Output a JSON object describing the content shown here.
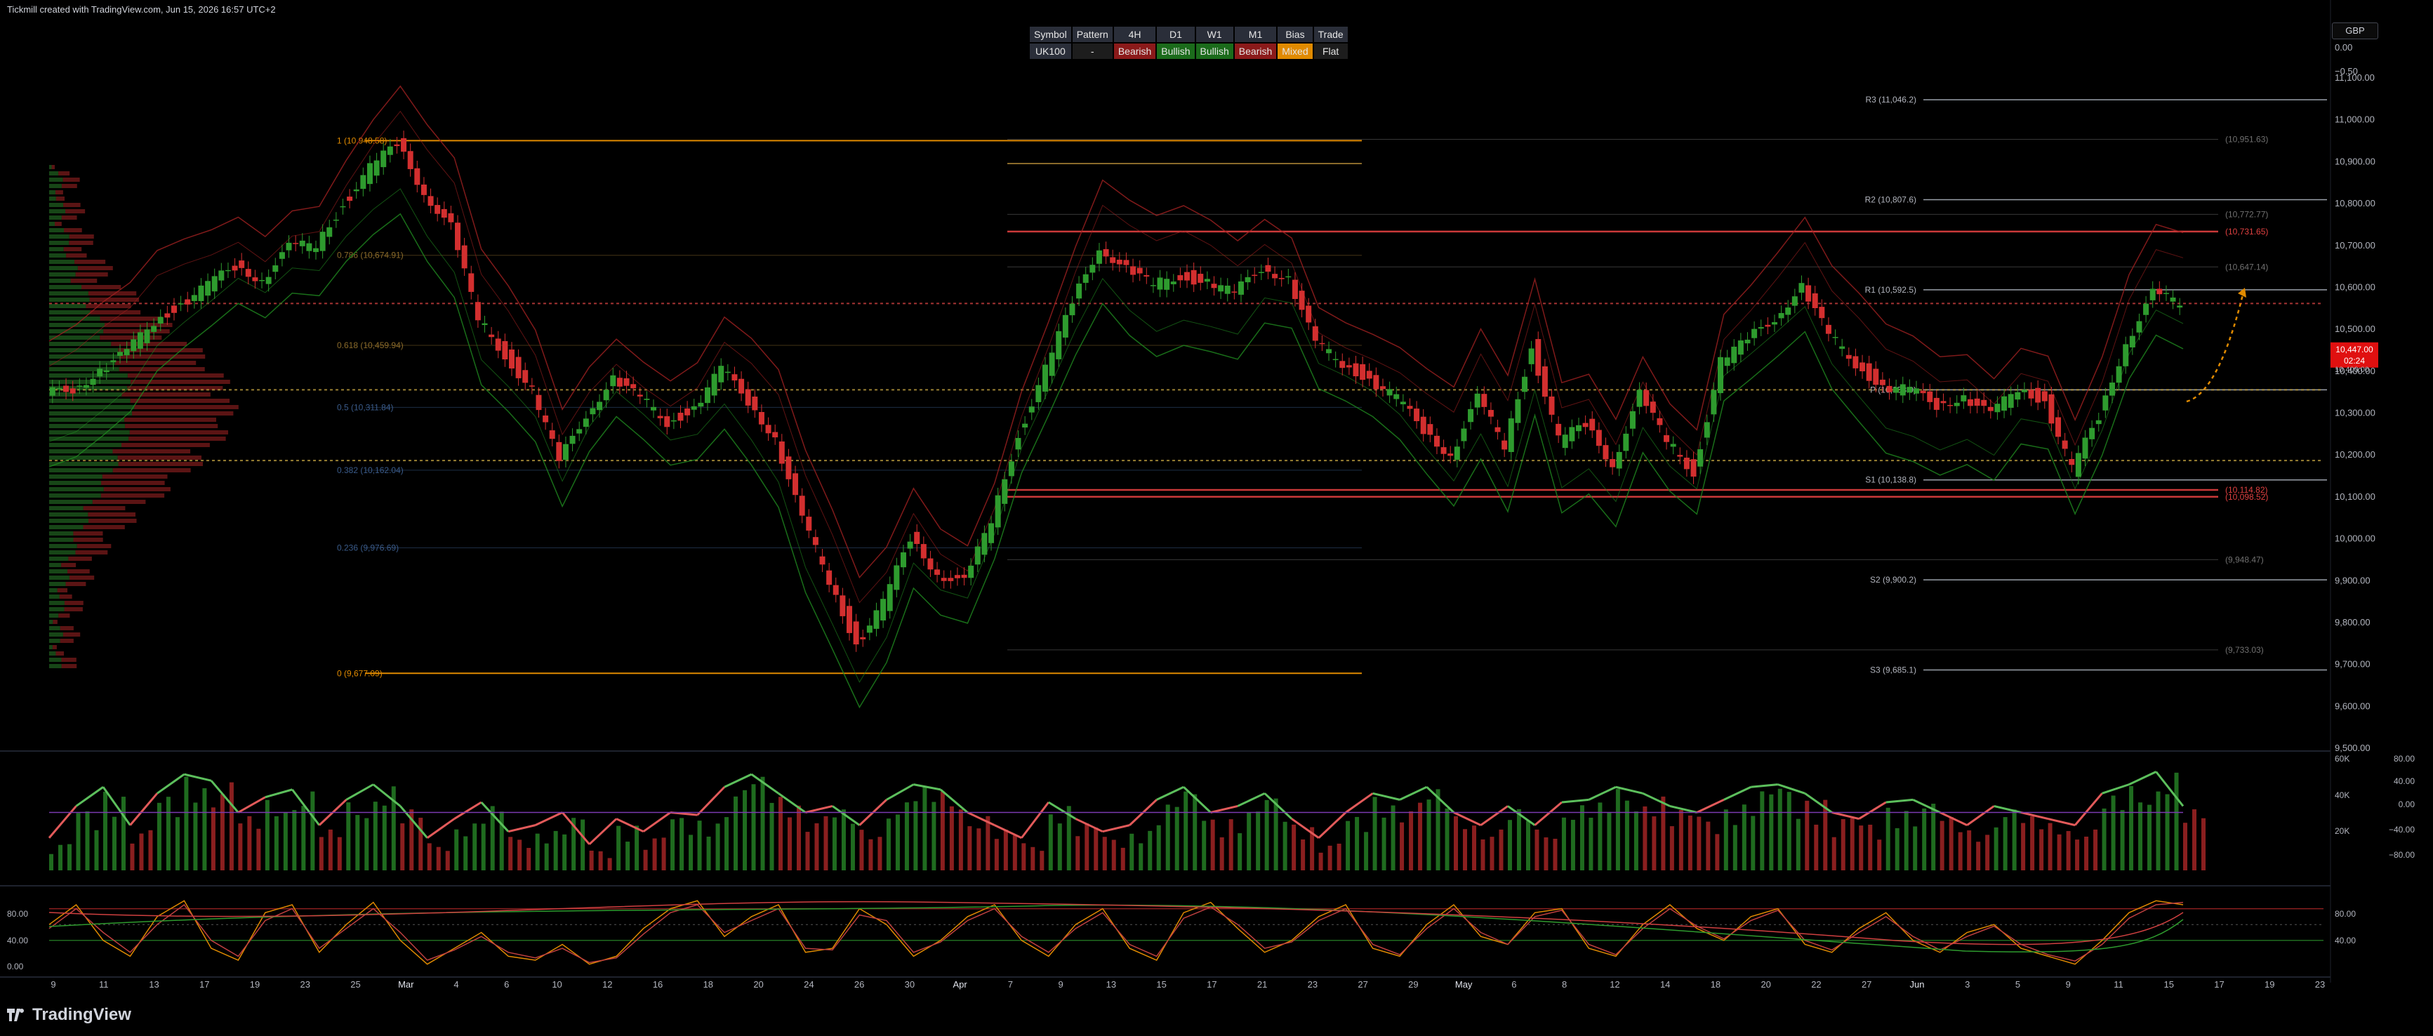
{
  "header": {
    "text": "Tickmill created with TradingView.com, Jun 15, 2026 16:57 UTC+2"
  },
  "brand": {
    "logo_text": "TradingView"
  },
  "currency": {
    "label": "GBP"
  },
  "bias_table": {
    "headers": [
      "Symbol",
      "Pattern",
      "4H",
      "D1",
      "W1",
      "M1",
      "Bias",
      "Trade"
    ],
    "row": [
      "UK100",
      "-",
      "Bearish",
      "Bullish",
      "Bullish",
      "Bearish",
      "Mixed",
      "Flat"
    ]
  },
  "colors": {
    "bull": "#26a69a",
    "bear": "#ef5350",
    "up_candle": "#2e9b2e",
    "down_candle": "#d32f2f",
    "fib": "#e08a00",
    "price_tag": "#e01010"
  },
  "chart_data": [
    {
      "type": "line",
      "title": "",
      "ylim": [
        9500,
        11100
      ],
      "y_ticks": [
        "11,100.00",
        "11,000.00",
        "10,900.00",
        "10,800.00",
        "10,700.00",
        "10,600.00",
        "10,500.00",
        "10,400.00",
        "10,300.00",
        "10,200.00",
        "10,100.00",
        "10,000.00",
        "9,900.00",
        "9,800.00",
        "9,700.00",
        "9,600.00",
        "9,500.00"
      ],
      "top_ticks": [
        "0.00",
        "−0.50"
      ],
      "x_ticks": [
        "9",
        "11",
        "13",
        "17",
        "19",
        "23",
        "25",
        "Mar",
        "4",
        "6",
        "10",
        "12",
        "16",
        "18",
        "20",
        "24",
        "26",
        "30",
        "Apr",
        "7",
        "9",
        "13",
        "15",
        "17",
        "21",
        "23",
        "27",
        "29",
        "May",
        "6",
        "8",
        "12",
        "14",
        "18",
        "20",
        "22",
        "27",
        "Jun",
        "3",
        "5",
        "9",
        "11",
        "15",
        "17",
        "19",
        "23"
      ],
      "series": [
        {
          "values": [
            10340,
            10360,
            10400,
            10440,
            10520,
            10560,
            10600,
            10650,
            10620,
            10690,
            10700,
            10800,
            10880,
            10940,
            10830,
            10740,
            10520,
            10440,
            10350,
            10180,
            10300,
            10380,
            10330,
            10280,
            10310,
            10400,
            10330,
            10240,
            10040,
            9900,
            9750,
            9840,
            10000,
            9920,
            9890,
            10040,
            10250,
            10400,
            10560,
            10700,
            10640,
            10600,
            10630,
            10610,
            10580,
            10650,
            10620,
            10460,
            10420,
            10380,
            10330,
            10260,
            10200,
            10330,
            10220,
            10460,
            10230,
            10270,
            10180,
            10340,
            10230,
            10160,
            10420,
            10470,
            10530,
            10600,
            10480,
            10420,
            10360,
            10350,
            10320,
            10340,
            10290,
            10360,
            10330,
            10160,
            10290,
            10470,
            10580,
            10560
          ]
        }
      ],
      "annotations": {
        "price_tag": "10,447.00",
        "price_timer": "02:24",
        "price_below": "10,400.00",
        "pivots": [
          {
            "label": "R3 (11,046.2)",
            "value": 11046.2
          },
          {
            "label": "R2 (10,807.6)",
            "value": 10807.6
          },
          {
            "label": "R1 (10,592.5)",
            "value": 10592.5
          },
          {
            "label": "P (10,353.9)",
            "value": 10353.9
          },
          {
            "label": "S1 (10,138.8)",
            "value": 10138.8
          },
          {
            "label": "S2 (9,900.2)",
            "value": 9900.2
          },
          {
            "label": "S3 (9,685.1)",
            "value": 9685.1
          }
        ],
        "fib": [
          {
            "label": "1 (10,948.58)",
            "value": 10948.58
          },
          {
            "label": "0.786 (10,674.91)",
            "value": 10674.91
          },
          {
            "label": "0.618 (10,459.94)",
            "value": 10459.94
          },
          {
            "label": "0.5 (10,311.84)",
            "value": 10311.84
          },
          {
            "label": "0.382 (10,162.04)",
            "value": 10162.04
          },
          {
            "label": "0.236 (9,976.69)",
            "value": 9976.69
          },
          {
            "label": "0 (9,677.09)",
            "value": 9677.09
          }
        ],
        "right_levels": [
          {
            "label": "(10,951.63)",
            "value": 10951.63
          },
          {
            "label": "(10,772.77)",
            "value": 10772.77
          },
          {
            "label": "(10,731.65)",
            "value": 10731.65
          },
          {
            "label": "(10,647.14)",
            "value": 10647.14
          },
          {
            "label": "(10,114.82)",
            "value": 10114.82
          },
          {
            "label": "(10,098.52)",
            "value": 10098.52
          },
          {
            "label": "(9,948.47)",
            "value": 9948.47
          },
          {
            "label": "(9,733.03)",
            "value": 9733.03
          }
        ]
      }
    },
    {
      "type": "bar",
      "title": "",
      "right_ticks_left": [
        "60K",
        "40K",
        "20K"
      ],
      "right_ticks_right": [
        "80.00",
        "40.00",
        "0.00",
        "−40.00",
        "−80.00"
      ],
      "series": [
        {
          "values": [
            20,
            45,
            60,
            30,
            55,
            70,
            65,
            40,
            52,
            58,
            30,
            50,
            62,
            45,
            20,
            35,
            48,
            25,
            30,
            40,
            15,
            35,
            25,
            40,
            38,
            60,
            70,
            55,
            40,
            45,
            30,
            50,
            62,
            58,
            40,
            30,
            20,
            48,
            35,
            25,
            30,
            50,
            60,
            40,
            45,
            55,
            35,
            20,
            40,
            55,
            50,
            60,
            40,
            30,
            45,
            30,
            48,
            50,
            60,
            55,
            45,
            40,
            50,
            60,
            62,
            55,
            40,
            35,
            48,
            50,
            40,
            30,
            45,
            40,
            35,
            30,
            55,
            62,
            72,
            45
          ]
        }
      ]
    },
    {
      "type": "line",
      "title": "",
      "y_ticks": [
        "80.00",
        "40.00",
        "0.00"
      ],
      "series": [
        {
          "values": [
            60,
            85,
            40,
            20,
            70,
            90,
            30,
            15,
            75,
            85,
            25,
            60,
            88,
            40,
            10,
            30,
            50,
            20,
            15,
            35,
            10,
            20,
            55,
            80,
            90,
            45,
            70,
            85,
            25,
            30,
            80,
            60,
            20,
            40,
            70,
            85,
            40,
            20,
            60,
            80,
            30,
            15,
            75,
            88,
            55,
            25,
            40,
            70,
            85,
            30,
            20,
            60,
            85,
            45,
            35,
            75,
            80,
            30,
            20,
            60,
            85,
            55,
            40,
            70,
            80,
            35,
            25,
            55,
            75,
            40,
            25,
            50,
            60,
            30,
            20,
            10,
            40,
            75,
            90,
            85
          ]
        },
        {
          "values": [
            55,
            80,
            50,
            25,
            60,
            85,
            40,
            20,
            65,
            80,
            30,
            55,
            80,
            50,
            15,
            28,
            45,
            25,
            18,
            30,
            12,
            18,
            48,
            75,
            85,
            50,
            65,
            80,
            30,
            28,
            72,
            65,
            25,
            38,
            65,
            80,
            45,
            25,
            55,
            75,
            35,
            20,
            68,
            82,
            60,
            30,
            38,
            65,
            80,
            35,
            22,
            55,
            80,
            50,
            35,
            70,
            78,
            35,
            22,
            55,
            80,
            58,
            42,
            65,
            78,
            40,
            28,
            50,
            70,
            45,
            28,
            45,
            58,
            35,
            22,
            14,
            35,
            68,
            85,
            88
          ]
        }
      ]
    }
  ]
}
